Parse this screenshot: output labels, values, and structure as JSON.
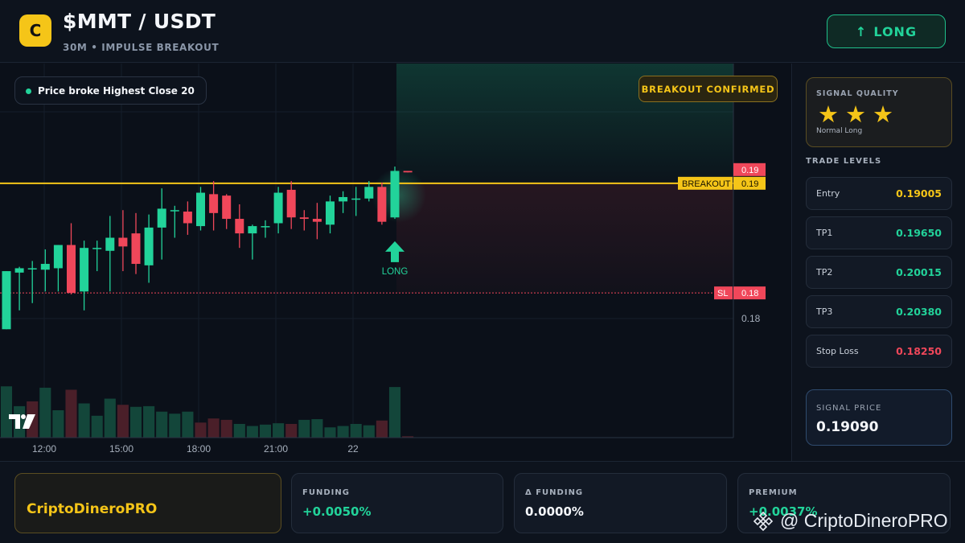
{
  "header": {
    "logo_letter": "C",
    "title": "$MMT / USDT",
    "subtitle": "30M • IMPULSE BREAKOUT",
    "long_button": {
      "arrow": "↑",
      "label": "LONG"
    }
  },
  "chart": {
    "badge_price_broke": "Price broke Highest Close 20",
    "badge_breakout_confirmed": "BREAKOUT CONFIRMED",
    "breakout_line_label": "BREAKOUT",
    "breakout_line_value": "0.19",
    "last_price_tag": "0.19",
    "sl_label": "SL",
    "sl_value": "0.18",
    "axis_price_label": "0.18",
    "signal_marker_label": "LONG"
  },
  "chart_data": {
    "type": "candlestick",
    "x_ticks": [
      "12:00",
      "15:00",
      "18:00",
      "21:00",
      "22"
    ],
    "ylim": [
      0.1778,
      0.1958
    ],
    "levels": {
      "breakout": 0.19005,
      "stop_loss": 0.1825
    },
    "candles": [
      {
        "o": 0.18,
        "h": 0.184,
        "l": 0.18,
        "c": 0.184
      },
      {
        "o": 0.1839,
        "h": 0.1843,
        "l": 0.1813,
        "c": 0.1842
      },
      {
        "o": 0.1842,
        "h": 0.1847,
        "l": 0.1818,
        "c": 0.1842
      },
      {
        "o": 0.1841,
        "h": 0.1855,
        "l": 0.1826,
        "c": 0.1845
      },
      {
        "o": 0.1842,
        "h": 0.1858,
        "l": 0.1826,
        "c": 0.1858
      },
      {
        "o": 0.1858,
        "h": 0.1873,
        "l": 0.1824,
        "c": 0.1825
      },
      {
        "o": 0.1826,
        "h": 0.1861,
        "l": 0.1813,
        "c": 0.1856
      },
      {
        "o": 0.1856,
        "h": 0.1861,
        "l": 0.184,
        "c": 0.1856
      },
      {
        "o": 0.1854,
        "h": 0.1878,
        "l": 0.1826,
        "c": 0.1863
      },
      {
        "o": 0.1863,
        "h": 0.1882,
        "l": 0.184,
        "c": 0.1857
      },
      {
        "o": 0.1866,
        "h": 0.188,
        "l": 0.1838,
        "c": 0.1845
      },
      {
        "o": 0.1844,
        "h": 0.1879,
        "l": 0.1832,
        "c": 0.187
      },
      {
        "o": 0.187,
        "h": 0.1897,
        "l": 0.1848,
        "c": 0.1883
      },
      {
        "o": 0.1882,
        "h": 0.1885,
        "l": 0.1863,
        "c": 0.1882
      },
      {
        "o": 0.1881,
        "h": 0.1888,
        "l": 0.1865,
        "c": 0.1873
      },
      {
        "o": 0.1871,
        "h": 0.1898,
        "l": 0.1868,
        "c": 0.1894
      },
      {
        "o": 0.1893,
        "h": 0.1902,
        "l": 0.1868,
        "c": 0.188
      },
      {
        "o": 0.1892,
        "h": 0.1893,
        "l": 0.1869,
        "c": 0.1876
      },
      {
        "o": 0.1876,
        "h": 0.1886,
        "l": 0.1856,
        "c": 0.1866
      },
      {
        "o": 0.1866,
        "h": 0.1872,
        "l": 0.1848,
        "c": 0.1871
      },
      {
        "o": 0.1871,
        "h": 0.1875,
        "l": 0.1863,
        "c": 0.1871
      },
      {
        "o": 0.1873,
        "h": 0.1898,
        "l": 0.1866,
        "c": 0.1894
      },
      {
        "o": 0.1896,
        "h": 0.1902,
        "l": 0.1869,
        "c": 0.1877
      },
      {
        "o": 0.1877,
        "h": 0.1882,
        "l": 0.1868,
        "c": 0.1876
      },
      {
        "o": 0.1876,
        "h": 0.1887,
        "l": 0.1862,
        "c": 0.1874
      },
      {
        "o": 0.1872,
        "h": 0.1892,
        "l": 0.1866,
        "c": 0.1888
      },
      {
        "o": 0.1888,
        "h": 0.1895,
        "l": 0.188,
        "c": 0.1891
      },
      {
        "o": 0.189,
        "h": 0.1898,
        "l": 0.1878,
        "c": 0.189
      },
      {
        "o": 0.189,
        "h": 0.1902,
        "l": 0.1888,
        "c": 0.1898
      },
      {
        "o": 0.1898,
        "h": 0.1901,
        "l": 0.1872,
        "c": 0.1874
      },
      {
        "o": 0.1877,
        "h": 0.1912,
        "l": 0.1876,
        "c": 0.1909
      },
      {
        "o": 0.1909,
        "h": 0.1909,
        "l": 0.1908,
        "c": 0.1908
      }
    ],
    "volumes": [
      {
        "v": 0.75,
        "up": true
      },
      {
        "v": 0.46,
        "up": true
      },
      {
        "v": 0.53,
        "up": false
      },
      {
        "v": 0.73,
        "up": true
      },
      {
        "v": 0.4,
        "up": true
      },
      {
        "v": 0.7,
        "up": false
      },
      {
        "v": 0.5,
        "up": true
      },
      {
        "v": 0.32,
        "up": true
      },
      {
        "v": 0.57,
        "up": true
      },
      {
        "v": 0.48,
        "up": false
      },
      {
        "v": 0.45,
        "up": true
      },
      {
        "v": 0.46,
        "up": true
      },
      {
        "v": 0.38,
        "up": true
      },
      {
        "v": 0.35,
        "up": true
      },
      {
        "v": 0.38,
        "up": true
      },
      {
        "v": 0.22,
        "up": false
      },
      {
        "v": 0.28,
        "up": false
      },
      {
        "v": 0.26,
        "up": false
      },
      {
        "v": 0.2,
        "up": true
      },
      {
        "v": 0.17,
        "up": true
      },
      {
        "v": 0.19,
        "up": true
      },
      {
        "v": 0.21,
        "up": true
      },
      {
        "v": 0.2,
        "up": false
      },
      {
        "v": 0.26,
        "up": true
      },
      {
        "v": 0.27,
        "up": true
      },
      {
        "v": 0.15,
        "up": true
      },
      {
        "v": 0.17,
        "up": true
      },
      {
        "v": 0.2,
        "up": true
      },
      {
        "v": 0.18,
        "up": true
      },
      {
        "v": 0.25,
        "up": false
      },
      {
        "v": 0.74,
        "up": true
      },
      {
        "v": 0.02,
        "up": false
      }
    ]
  },
  "side": {
    "signal_quality_label": "SIGNAL QUALITY",
    "stars_filled": 3,
    "stars_total": 3,
    "quality_text": "Normal Long",
    "trade_levels_heading": "TRADE LEVELS",
    "levels": [
      {
        "label": "Entry",
        "value": "0.19005",
        "color": "#f5c518"
      },
      {
        "label": "TP1",
        "value": "0.19650",
        "color": "#22d39a"
      },
      {
        "label": "TP2",
        "value": "0.20015",
        "color": "#22d39a"
      },
      {
        "label": "TP3",
        "value": "0.20380",
        "color": "#22d39a"
      },
      {
        "label": "Stop Loss",
        "value": "0.18250",
        "color": "#f0475a"
      }
    ],
    "signal_price_label": "SIGNAL PRICE",
    "signal_price_value": "0.19090"
  },
  "footer": {
    "brand": "CriptoDineroPRO",
    "stats": [
      {
        "label": "FUNDING",
        "value": "+0.0050%",
        "color": "#22d39a"
      },
      {
        "label": "Δ FUNDING",
        "value": "0.0000%",
        "color": "#f4f6fa"
      },
      {
        "label": "PREMIUM",
        "value": "+0.0037%",
        "color": "#22d39a"
      }
    ],
    "watermark": "@ CriptoDineroPRO"
  },
  "colors": {
    "accent_yellow": "#f5c518",
    "up_green": "#22d39a",
    "down_red": "#f0475a",
    "volume_up": "#13463a",
    "volume_down": "#4a1f29",
    "background": "#0c111b"
  }
}
